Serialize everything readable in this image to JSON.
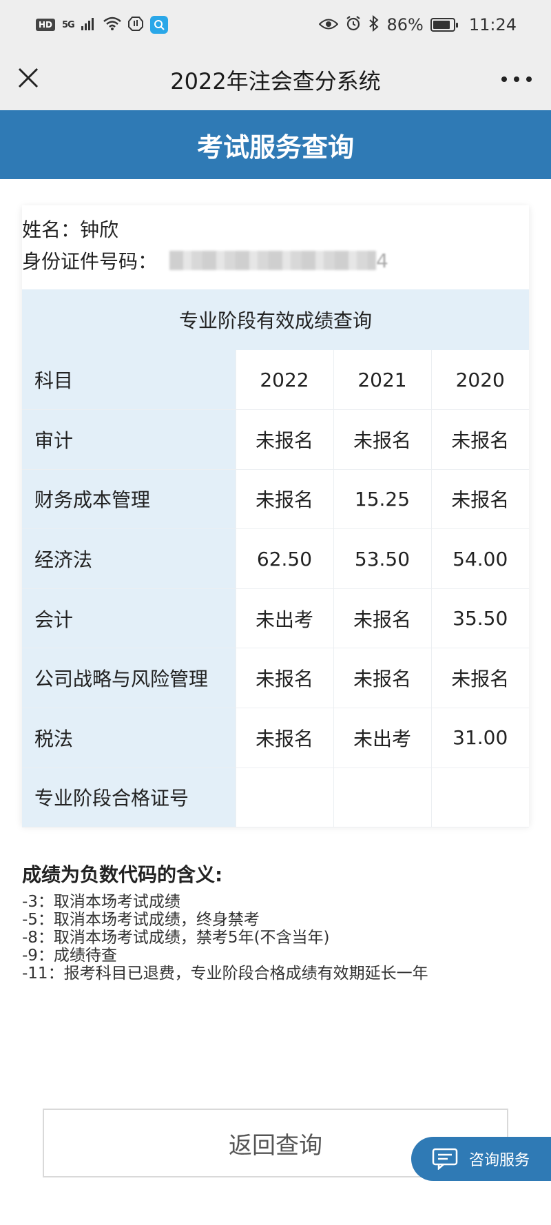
{
  "status_bar": {
    "hd": "HD",
    "network": "5G",
    "battery": "86%",
    "battery_fraction": 0.86,
    "time": "11:24"
  },
  "title_bar": {
    "title": "2022年注会查分系统"
  },
  "banner": {
    "title": "考试服务查询"
  },
  "info": {
    "name_label": "姓名：",
    "name_value": "钟欣",
    "id_label": "身份证件号码：",
    "id_visible_tail": "4"
  },
  "scores": {
    "section_title": "专业阶段有效成绩查询",
    "header": {
      "subject": "科目",
      "years": [
        "2022",
        "2021",
        "2020"
      ]
    },
    "rows": [
      {
        "subject": "审计",
        "values": [
          "未报名",
          "未报名",
          "未报名"
        ]
      },
      {
        "subject": "财务成本管理",
        "values": [
          "未报名",
          "15.25",
          "未报名"
        ]
      },
      {
        "subject": "经济法",
        "values": [
          "62.50",
          "53.50",
          "54.00"
        ]
      },
      {
        "subject": "会计",
        "values": [
          "未出考",
          "未报名",
          "35.50"
        ]
      },
      {
        "subject": "公司战略与风险管理",
        "values": [
          "未报名",
          "未报名",
          "未报名"
        ]
      },
      {
        "subject": "税法",
        "values": [
          "未报名",
          "未出考",
          "31.00"
        ]
      },
      {
        "subject": "专业阶段合格证号",
        "values": [
          "",
          "",
          ""
        ]
      }
    ]
  },
  "notes": {
    "title": "成绩为负数代码的含义:",
    "lines": [
      "-3：取消本场考试成绩",
      "-5：取消本场考试成绩，终身禁考",
      "-8：取消本场考试成绩，禁考5年(不含当年)",
      "-9：成绩待查",
      "-11：报考科目已退费，专业阶段合格成绩有效期延长一年"
    ]
  },
  "buttons": {
    "back": "返回查询",
    "consult": "咨询服务"
  },
  "colors": {
    "brand_blue": "#2f7ab5",
    "light_blue": "#e3eff8",
    "chrome_gray": "#eeeeee"
  }
}
